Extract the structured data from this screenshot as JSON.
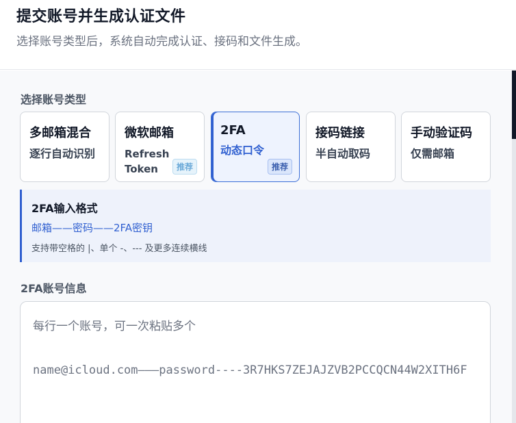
{
  "header": {
    "title": "提交账号并生成认证文件",
    "subtitle": "选择账号类型后，系统自动完成认证、接码和文件生成。"
  },
  "account_type": {
    "label": "选择账号类型",
    "cards": [
      {
        "title": "多邮箱混合",
        "desc": "逐行自动识别",
        "badge": ""
      },
      {
        "title": "微软邮箱",
        "desc": "Refresh Token",
        "badge": "推荐"
      },
      {
        "title": "2FA",
        "desc": "动态口令",
        "badge": "推荐",
        "selected": true
      },
      {
        "title": "接码链接",
        "desc": "半自动取码",
        "badge": ""
      },
      {
        "title": "手动验证码",
        "desc": "仅需邮箱",
        "badge": ""
      }
    ]
  },
  "format_hint": {
    "title": "2FA输入格式",
    "pattern": "邮箱——密码——2FA密钥",
    "note": "支持带空格的 |、单个 -、--- 及更多连续横线"
  },
  "account_info": {
    "label": "2FA账号信息",
    "placeholder": "每行一个账号，可一次粘贴多个\n\nname@icloud.com———password----3R7HKS7ZEJAJZVB2PCCQCN44W2XITH6F"
  },
  "colors": {
    "accent": "#2f5fd0",
    "selected_bg": "#eef3fe",
    "panel_bg": "#f8f9fb"
  }
}
